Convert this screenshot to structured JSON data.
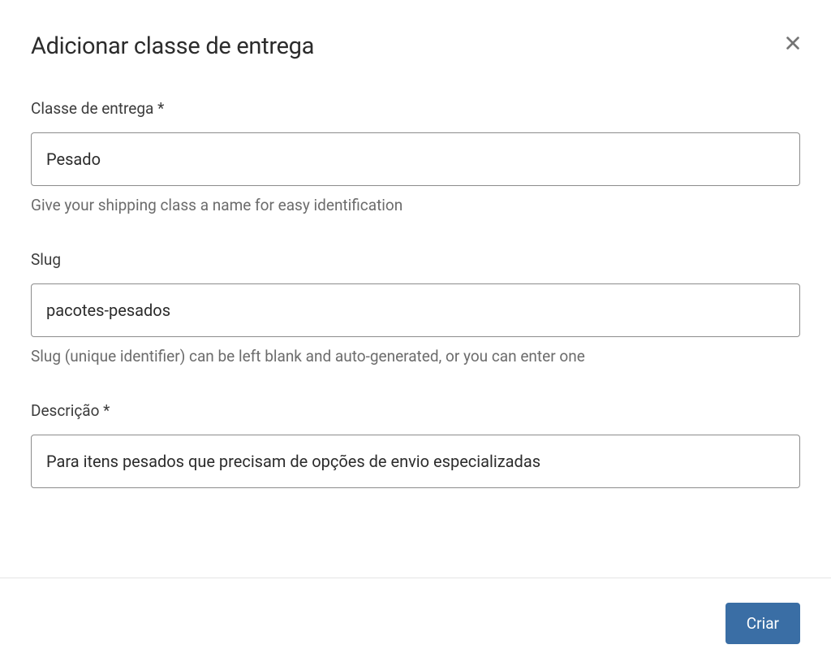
{
  "modal": {
    "title": "Adicionar classe de entrega"
  },
  "fields": {
    "shipping_class": {
      "label": "Classe de entrega *",
      "value": "Pesado",
      "help": "Give your shipping class a name for easy identification"
    },
    "slug": {
      "label": "Slug",
      "value": "pacotes-pesados",
      "help": "Slug (unique identifier) can be left blank and auto-generated, or you can enter one"
    },
    "description": {
      "label": "Descrição *",
      "value": "Para itens pesados que precisam de opções de envio especializadas"
    }
  },
  "footer": {
    "create_label": "Criar"
  }
}
